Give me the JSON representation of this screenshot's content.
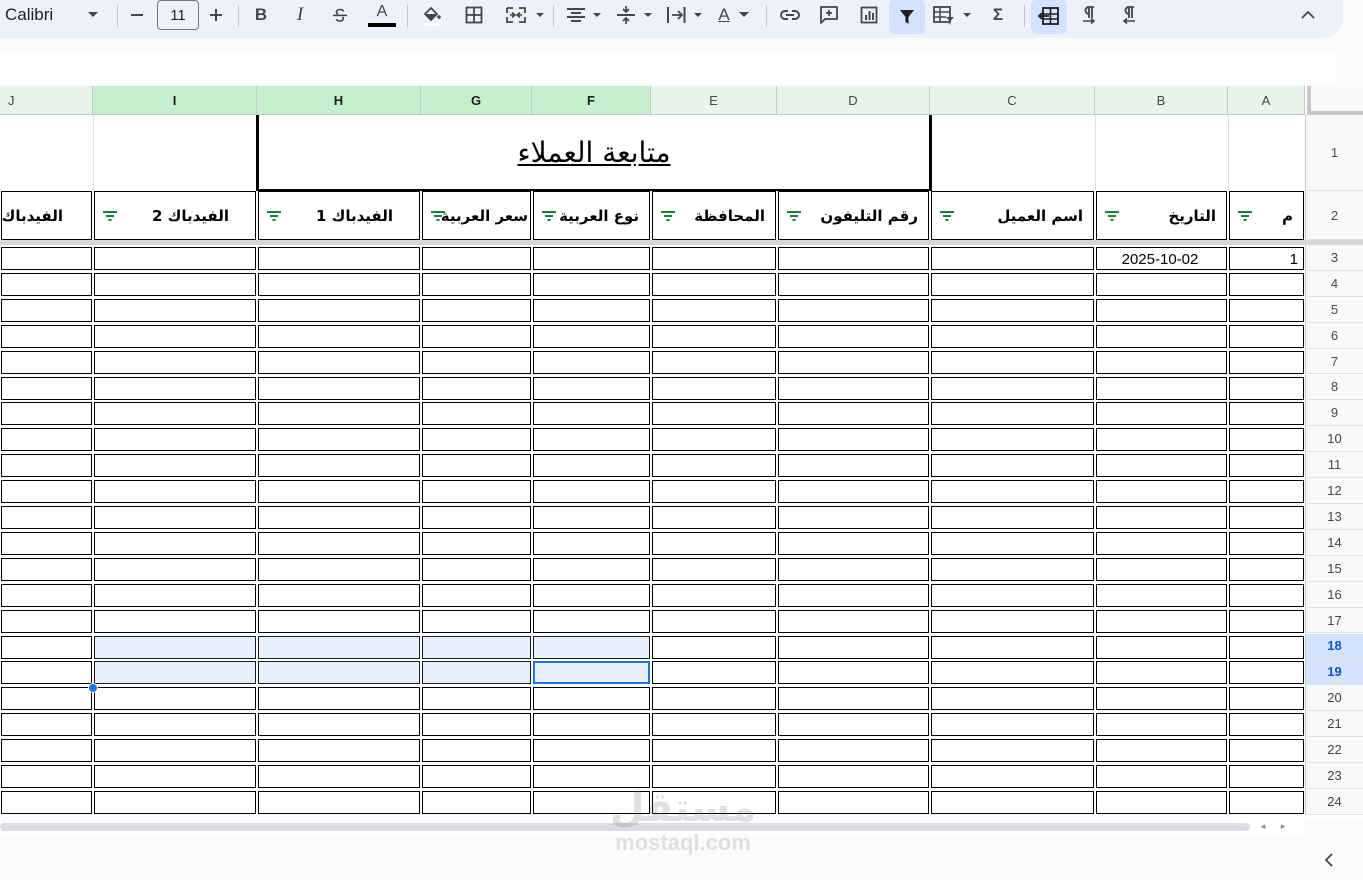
{
  "toolbar": {
    "font_name": "Calibri",
    "font_size": "11",
    "icons": [
      "chevron-down-icon",
      "minus-icon",
      "plus-icon",
      "bold-icon",
      "italic-icon",
      "strikethrough-icon",
      "text-color-icon",
      "fill-color-icon",
      "borders-icon",
      "merge-cells-icon",
      "horizontal-align-icon",
      "vertical-align-icon",
      "text-wrap-icon",
      "text-rotation-icon",
      "link-icon",
      "comment-icon",
      "chart-icon",
      "filter-icon",
      "filter-views-icon",
      "functions-icon",
      "rtl-sheet-icon",
      "ltr-text-icon",
      "rtl-text-icon",
      "collapse-toolbar-icon"
    ],
    "bold_label": "B",
    "italic_label": "I",
    "text_color_label": "A",
    "rotation_label": "A",
    "sum_label": "Σ",
    "text_color": "#000000"
  },
  "grid": {
    "columns": [
      {
        "id": "A",
        "label": "A",
        "selected": false
      },
      {
        "id": "B",
        "label": "B",
        "selected": false
      },
      {
        "id": "C",
        "label": "C",
        "selected": false
      },
      {
        "id": "D",
        "label": "D",
        "selected": false
      },
      {
        "id": "E",
        "label": "E",
        "selected": false
      },
      {
        "id": "F",
        "label": "F",
        "selected": true
      },
      {
        "id": "G",
        "label": "G",
        "selected": true
      },
      {
        "id": "H",
        "label": "H",
        "selected": true
      },
      {
        "id": "I",
        "label": "I",
        "selected": true
      },
      {
        "id": "J",
        "label": "J",
        "selected": false
      }
    ],
    "rows": [
      "1",
      "2",
      "3",
      "4",
      "5",
      "6",
      "7",
      "8",
      "9",
      "10",
      "11",
      "12",
      "13",
      "14",
      "15",
      "16",
      "17",
      "18",
      "19",
      "20",
      "21",
      "22",
      "23",
      "24"
    ],
    "selected_rows": [
      "18",
      "19"
    ],
    "title": "متابعة العملاء",
    "headers": {
      "A": "م",
      "B": "التاريخ",
      "C": "اسم العميل",
      "D": "رقم التليفون",
      "E": "المحافظة",
      "F": "نوع العربية",
      "G": "سعر العربية",
      "H": "الفيدباك 1",
      "I": "الفيدباك 2",
      "J": "الفيدباك"
    },
    "row3": {
      "A": "1",
      "B": "2025-10-02"
    }
  },
  "scroll": {
    "left_arrow": "◂",
    "right_arrow": "▸"
  },
  "watermark": {
    "logo": "مستقل",
    "text": "mostaql.com"
  },
  "colors": {
    "accent": "#1a73e8",
    "selected_header": "#c6efce",
    "selection_fill": "#e7f0fd"
  }
}
